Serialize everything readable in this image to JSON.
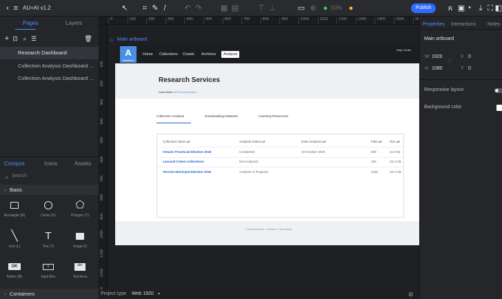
{
  "topbar": {
    "project_name": "AU+AI v1.2",
    "zoom": "50%",
    "publish_label": "Publish"
  },
  "left_panel": {
    "tabs": [
      "Pages",
      "Layers"
    ],
    "pages": [
      {
        "label": "Research Dashboard"
      },
      {
        "label": "Collection Analysis Dashboard ..."
      },
      {
        "label": "Collection Analysis Dashboard ..."
      }
    ],
    "comp_tabs": [
      "Compos",
      "Icons",
      "Assets"
    ],
    "search_placeholder": "Search",
    "section_basic": "Basic",
    "components": [
      {
        "label": "Rectangle (R)",
        "icon": "rectangle-icon"
      },
      {
        "label": "Circle (O)",
        "icon": "circle-icon"
      },
      {
        "label": "Polygon (Y)",
        "icon": "polygon-icon"
      },
      {
        "label": "Line (L)",
        "icon": "line-icon"
      },
      {
        "label": "Text (T)",
        "icon": "text-icon"
      },
      {
        "label": "Image (I)",
        "icon": "image-icon"
      },
      {
        "label": "Button (B)",
        "icon": "button-icon",
        "glyph": "OK"
      },
      {
        "label": "Input Box",
        "icon": "input-icon",
        "glyph": "I"
      },
      {
        "label": "Text Area",
        "icon": "textarea-icon",
        "glyph": "abc"
      }
    ],
    "section_containers": "Containers"
  },
  "ruler_top": [
    "0",
    "100",
    "200",
    "300",
    "400",
    "500",
    "600",
    "700",
    "800",
    "900",
    "1000",
    "1100",
    "1200",
    "1300",
    "1400",
    "1500",
    "1600"
  ],
  "ruler_left": [
    "100",
    "200",
    "300",
    "400",
    "500",
    "600",
    "700",
    "800",
    "900",
    "1000",
    "1100",
    "1200",
    "1300"
  ],
  "canvas": {
    "artboard_label": "Main artboard"
  },
  "artboard": {
    "logo_text": "ARCHIVE-IT",
    "help_center": "Help Center",
    "nav": [
      "Home",
      "Collections",
      "Crawls",
      "Archives",
      "Analysis"
    ],
    "title": "Research Services",
    "learn_label": "Learn More:",
    "learn_link": "ARI Documentation",
    "tabs": [
      "Collection Analysis",
      "Downloading Datasets",
      "Learning Resources"
    ],
    "table": {
      "headers": [
        "Collection Name",
        "Analysis Status",
        "Date Analyzed",
        "Files",
        "Size"
      ],
      "rows": [
        [
          "Ontario Provincial Election 2018",
          "Completed",
          "19 October 2020",
          "939",
          "113 GB"
        ],
        [
          "Leonard Cohen Collections",
          "Not Analyzed",
          "",
          "155",
          "34.3 GB"
        ],
        [
          "Toronto Municipal Election 2018",
          "Analysis In Progress",
          "",
          "1108",
          "34.3 GB"
        ]
      ]
    },
    "footer": "© Internet Archive · Archive-It · Help Center"
  },
  "right_panel": {
    "tabs": [
      "Properties",
      "Interactions",
      "Notes"
    ],
    "artboard_name": "Main artboard",
    "w_label": "W",
    "w_value": "1920",
    "h_label": "H",
    "h_value": "1080",
    "x_label": "X",
    "x_value": "0",
    "y_label": "Y",
    "y_value": "0",
    "responsive_layout": "Responsive layout",
    "background_color": "Background color"
  },
  "bottombar": {
    "project_type_label": "Project type",
    "project_type_value": "Web 1920"
  },
  "colors": {
    "accent": "#2f6bff",
    "link": "#1c5fd1",
    "logo": "#4a90e2"
  }
}
